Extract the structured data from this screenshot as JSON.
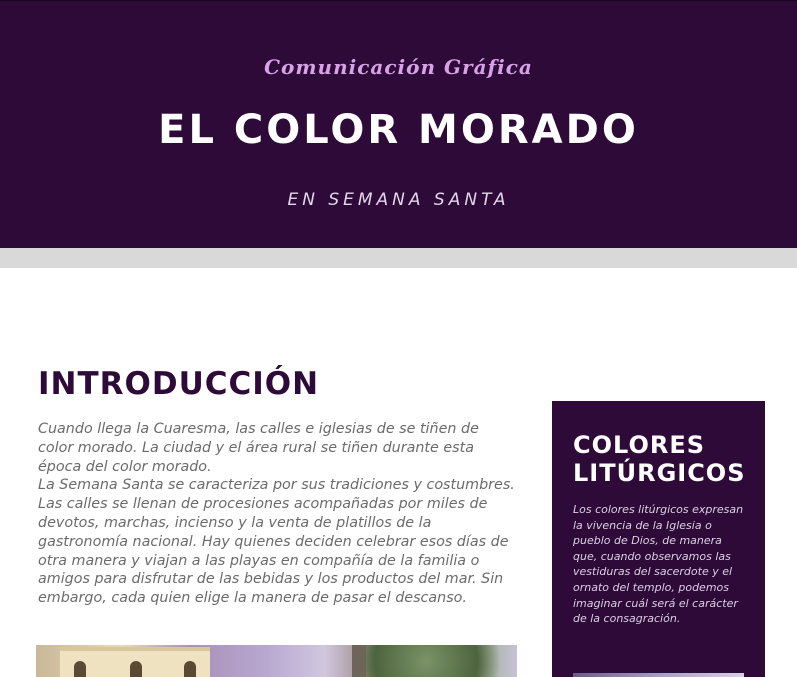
{
  "hero": {
    "kicker": "Comunicación Gráfica",
    "title": "EL COLOR MORADO",
    "subtitle": "EN SEMANA SANTA"
  },
  "intro": {
    "title": "INTRODUCCIÓN",
    "paragraph_1": "Cuando llega la Cuaresma, las calles e iglesias de se tiñen de color morado. La ciudad y el área rural se tiñen durante esta época del color morado.",
    "paragraph_2": "La Semana Santa se caracteriza por sus tradiciones y costumbres. Las calles se llenan de procesiones acompañadas por miles de devotos, marchas, incienso y la venta de platillos de la gastronomía nacional. Hay quienes deciden celebrar esos días de otra manera y viajan a las playas en compañía de la familia o amigos para disfrutar de las bebidas y los productos del mar. Sin embargo, cada quien elige la manera de pasar el descanso."
  },
  "sidebar": {
    "title": "COLORES LITÚRGICOS",
    "text": "Los colores litúrgicos expresan la vivencia de la Iglesia o pueblo de Dios, de manera que, cuando observamos las vestiduras del sacerdote y el ornato del templo, podemos imaginar cuál será el carácter de la consagración."
  },
  "colors": {
    "primary": "#2d0a38",
    "accent": "#d7a3e6",
    "band": "#d9d9d9",
    "body_text": "#6b6b6b"
  }
}
